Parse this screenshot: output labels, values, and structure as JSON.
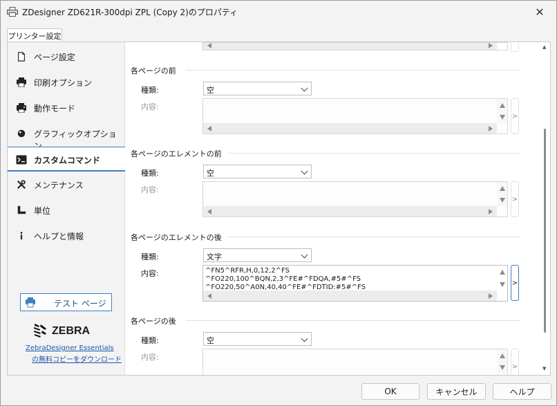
{
  "window": {
    "title": "ZDesigner ZD621R-300dpi ZPL (Copy 2)のプロパティ",
    "close_glyph": "✕"
  },
  "tabs": [
    {
      "label": "プリンター設定"
    }
  ],
  "sidebar": {
    "items": [
      {
        "label": "ページ設定",
        "icon": "page-setup-icon"
      },
      {
        "label": "印刷オプション",
        "icon": "printer-icon"
      },
      {
        "label": "動作モード",
        "icon": "operation-mode-icon"
      },
      {
        "label": "グラフィックオプション",
        "icon": "graphics-icon"
      },
      {
        "label": "カスタムコマンド",
        "icon": "terminal-icon",
        "active": true
      },
      {
        "label": "メンテナンス",
        "icon": "tools-icon"
      },
      {
        "label": "単位",
        "icon": "ruler-icon"
      },
      {
        "label": "ヘルプと情報",
        "icon": "info-icon"
      }
    ],
    "test_page_label": "テスト ページ",
    "brand_name": "ZEBRA",
    "link_line1": "ZebraDesigner Essentials",
    "link_line2": "の無料コピーをダウンロード"
  },
  "sections": [
    {
      "title": "各ページの前",
      "type_label": "種類:",
      "type_value": "空",
      "content_label": "内容:",
      "content_text": ""
    },
    {
      "title": "各ページのエレメントの前",
      "type_label": "種類:",
      "type_value": "空",
      "content_label": "内容:",
      "content_text": ""
    },
    {
      "title": "各ページのエレメントの後",
      "type_label": "種類:",
      "type_value": "文字",
      "content_label": "内容:",
      "content_text": "^FN5^RFR,H,0,12,2^FS\n^FO220,100^BQN,2,3^FE#^FDQA,#5#^FS\n^FO220,50^A0N,40,40^FE#^FDTID:#5#^FS"
    },
    {
      "title": "各ページの後",
      "type_label": "種類:",
      "type_value": "空",
      "content_label": "内容:",
      "content_text": ""
    }
  ],
  "expand_glyph": ">",
  "footer": {
    "ok": "OK",
    "cancel": "キャンセル",
    "help": "ヘルプ"
  }
}
